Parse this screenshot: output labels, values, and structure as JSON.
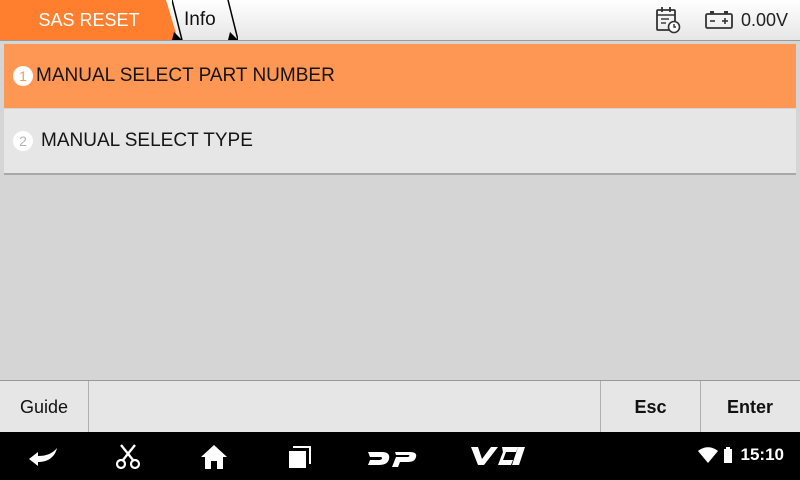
{
  "header": {
    "tab_active": "SAS RESET",
    "tab_info": "Info",
    "voltage": "0.00V",
    "icons": [
      "calendar-clock-icon",
      "battery-icon"
    ]
  },
  "menu": {
    "items": [
      {
        "number": "1",
        "label": "MANUAL SELECT PART NUMBER",
        "selected": true
      },
      {
        "number": "2",
        "label": "MANUAL SELECT TYPE",
        "selected": false
      }
    ]
  },
  "buttons": {
    "guide": "Guide",
    "esc": "Esc",
    "enter": "Enter"
  },
  "system_bar": {
    "icons": [
      "back-icon",
      "scissors-icon",
      "home-icon",
      "recent-apps-icon",
      "dp-logo-icon",
      "vci-logo-icon"
    ],
    "time": "15:10"
  },
  "colors": {
    "accent": "#fe9654",
    "header_tab": "#ff7f2f",
    "background": "#d5d5d5",
    "nav_bar": "#000000"
  }
}
